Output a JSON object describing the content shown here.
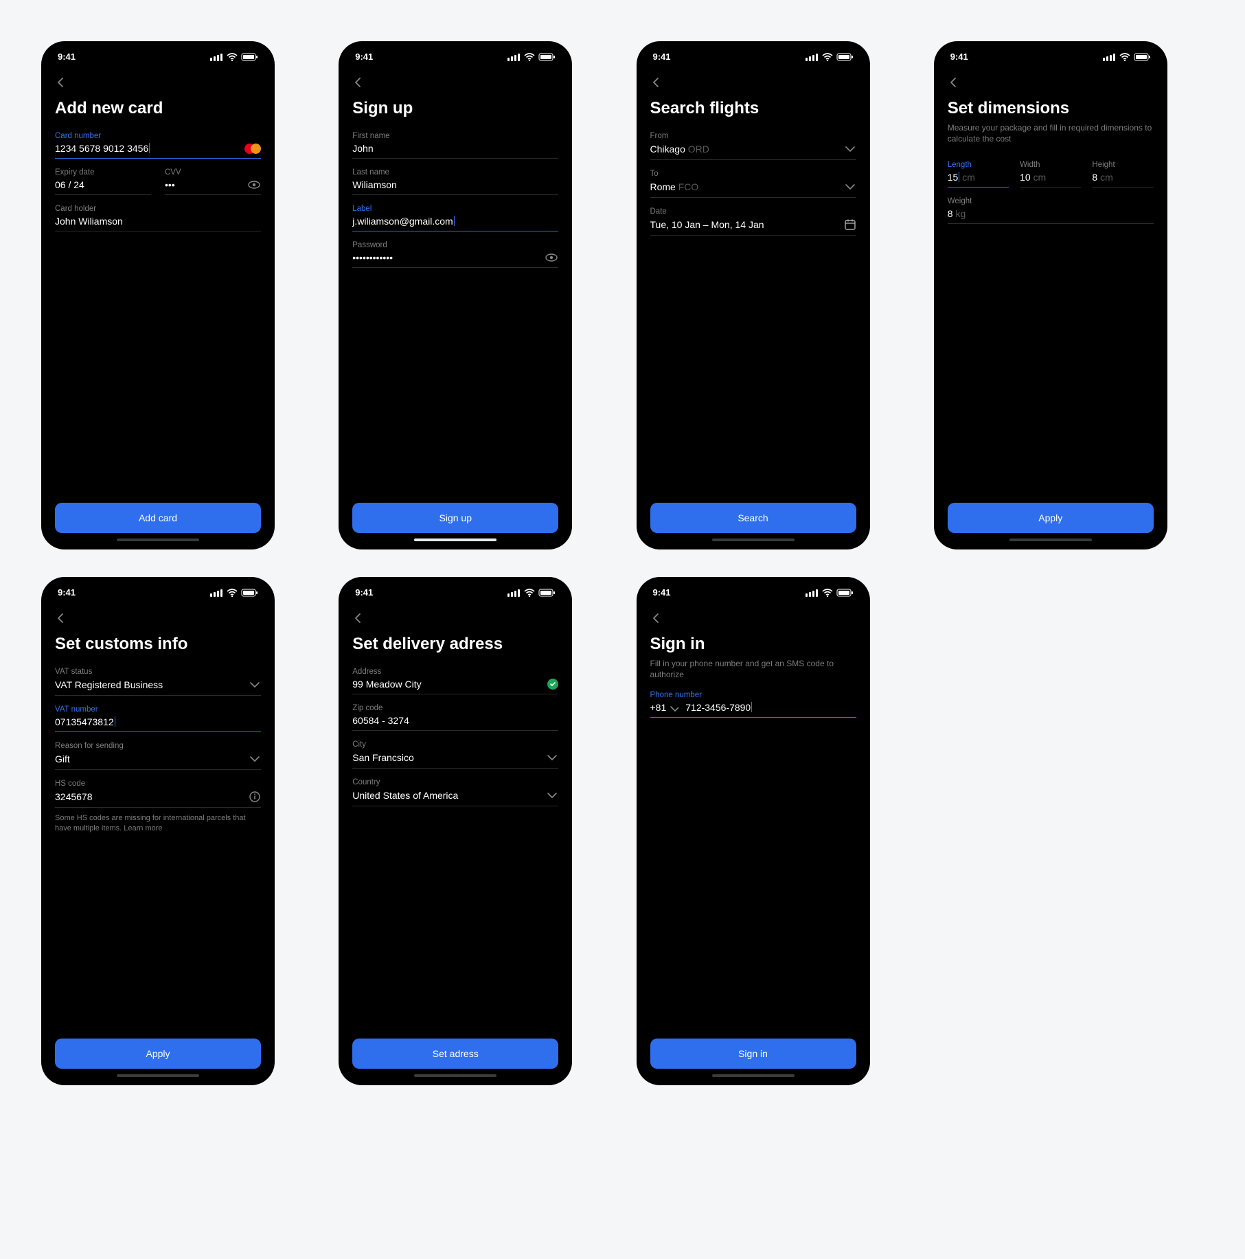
{
  "statusbar": {
    "time": "9:41"
  },
  "screens": {
    "add_card": {
      "title": "Add new card",
      "card_number": {
        "label": "Card number",
        "value": "1234  5678  9012  3456"
      },
      "expiry": {
        "label": "Expiry date",
        "value": "06 / 24"
      },
      "cvv": {
        "label": "CVV",
        "value": "•••"
      },
      "holder": {
        "label": "Card holder",
        "value": "John Wiliamson"
      },
      "button": "Add card"
    },
    "sign_up": {
      "title": "Sign up",
      "first_name": {
        "label": "First name",
        "value": "John"
      },
      "last_name": {
        "label": "Last name",
        "value": "Wiliamson"
      },
      "email": {
        "label": "Label",
        "value": "j.wiliamson@gmail.com"
      },
      "password": {
        "label": "Password",
        "value": "••••••••••••"
      },
      "button": "Sign up"
    },
    "search_flights": {
      "title": "Search flights",
      "from": {
        "label": "From",
        "city": "Chikago",
        "code": "ORD"
      },
      "to": {
        "label": "To",
        "city": "Rome",
        "code": "FCO"
      },
      "date": {
        "label": "Date",
        "value": "Tue, 10 Jan – Mon, 14 Jan"
      },
      "button": "Search"
    },
    "dimensions": {
      "title": "Set dimensions",
      "subtitle": "Measure your package and fill in required dimensions to calculate the cost",
      "length": {
        "label": "Length",
        "value": "15",
        "unit": "cm"
      },
      "width": {
        "label": "Width",
        "value": "10",
        "unit": "cm"
      },
      "height": {
        "label": "Height",
        "value": "8",
        "unit": "cm"
      },
      "weight": {
        "label": "Weight",
        "value": "8",
        "unit": "kg"
      },
      "button": "Apply"
    },
    "customs": {
      "title": "Set customs info",
      "vat_status": {
        "label": "VAT status",
        "value": "VAT Registered Business"
      },
      "vat_number": {
        "label": "VAT number",
        "value": "07135473812"
      },
      "reason": {
        "label": "Reason for sending",
        "value": "Gift"
      },
      "hs_code": {
        "label": "HS code",
        "value": "3245678"
      },
      "helper": "Some HS codes are missing for international parcels that have multiple items. Learn more",
      "button": "Apply"
    },
    "delivery": {
      "title": "Set delivery adress",
      "address": {
        "label": "Address",
        "value": "99 Meadow City"
      },
      "zip": {
        "label": "Zip code",
        "value": "60584 - 3274"
      },
      "city": {
        "label": "City",
        "value": "San Francsico"
      },
      "country": {
        "label": "Country",
        "value": "United States of America"
      },
      "button": "Set adress"
    },
    "sign_in": {
      "title": "Sign in",
      "subtitle": "Fill in your phone number and get an SMS code to authorize",
      "phone": {
        "label": "Phone number",
        "country_code": "+81",
        "number": "712-3456-7890"
      },
      "button": "Sign in"
    }
  }
}
